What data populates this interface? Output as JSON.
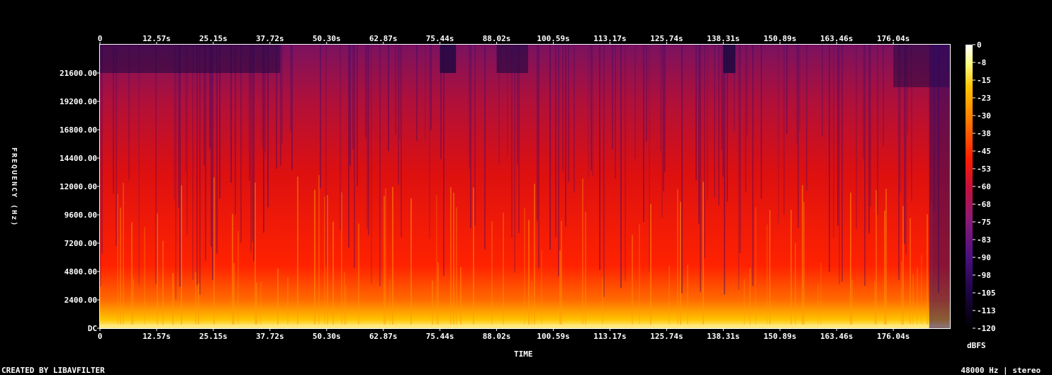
{
  "chart_data": {
    "type": "heatmap",
    "title": "",
    "xlabel": "TIME",
    "ylabel": "FREQUENCY (Hz)",
    "x_ticks": [
      "0",
      "12.57s",
      "25.15s",
      "37.72s",
      "50.30s",
      "62.87s",
      "75.44s",
      "88.02s",
      "100.59s",
      "113.17s",
      "125.74s",
      "138.31s",
      "150.89s",
      "163.46s",
      "176.04s"
    ],
    "y_ticks": [
      "DC",
      "2400.00",
      "4800.00",
      "7200.00",
      "9600.00",
      "12000.00",
      "14400.00",
      "16800.00",
      "19200.00",
      "21600.00"
    ],
    "y_tick_values_hz": [
      0,
      2400,
      4800,
      7200,
      9600,
      12000,
      14400,
      16800,
      19200,
      21600
    ],
    "xlim_s": [
      0,
      188.6
    ],
    "ylim_hz": [
      0,
      24000
    ],
    "colorbar": {
      "unit": "dBFS",
      "ticks": [
        "0",
        "-8",
        "-15",
        "-23",
        "-30",
        "-38",
        "-45",
        "-53",
        "-60",
        "-68",
        "-75",
        "-83",
        "-90",
        "-98",
        "-105",
        "-113",
        "-120"
      ],
      "range_db": [
        -120,
        0
      ],
      "colormap": [
        "#000000",
        "#1a0540",
        "#4a1080",
        "#8a1a78",
        "#c8103a",
        "#ff1e00",
        "#ff7000",
        "#ffc400",
        "#ffff90",
        "#ffffff"
      ]
    }
  },
  "footer": {
    "left": "CREATED BY LIBAVFILTER",
    "right": "48000 Hz | stereo"
  }
}
